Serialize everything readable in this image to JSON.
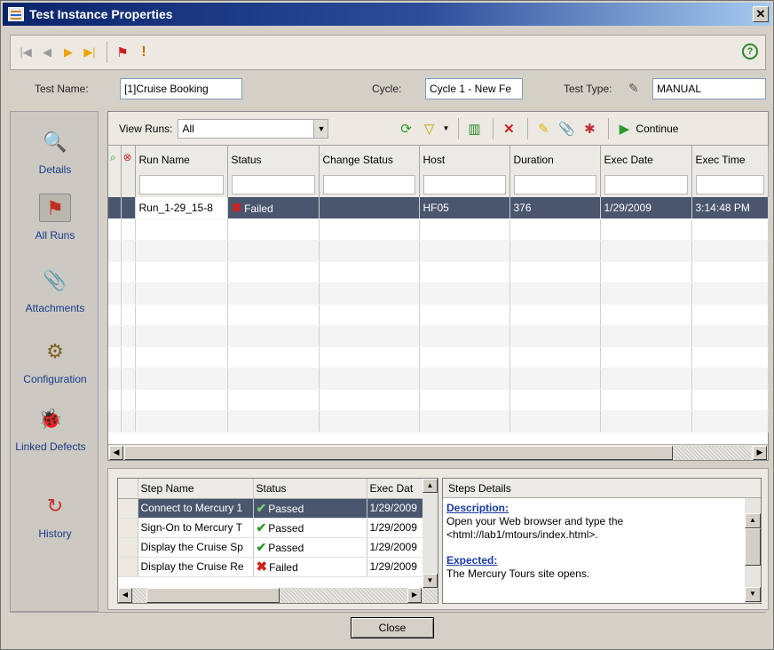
{
  "window": {
    "title": "Test Instance Properties"
  },
  "fields": {
    "test_name_label": "Test Name:",
    "test_name_value": "[1]Cruise Booking",
    "cycle_label": "Cycle:",
    "cycle_value": "Cycle 1 - New Fe",
    "test_type_label": "Test Type:",
    "test_type_value": "MANUAL"
  },
  "sidebar": {
    "items": [
      {
        "label": "Details",
        "icon": "details-icon"
      },
      {
        "label": "All Runs",
        "icon": "runs-icon",
        "selected": true
      },
      {
        "label": "Attachments",
        "icon": "paperclip-icon"
      },
      {
        "label": "Configuration",
        "icon": "configuration-icon"
      },
      {
        "label": "Linked Defects",
        "icon": "linked-defects-icon"
      },
      {
        "label": "History",
        "icon": "history-icon"
      }
    ]
  },
  "runs_toolbar": {
    "view_runs_label": "View Runs:",
    "view_runs_value": "All",
    "continue_label": "Continue"
  },
  "runs_grid": {
    "columns": [
      "Run Name",
      "Status",
      "Change Status",
      "Host",
      "Duration",
      "Exec Date",
      "Exec Time"
    ],
    "rows": [
      {
        "run_name": "Run_1-29_15-8",
        "status": "Failed",
        "change_status": "",
        "host": "HF05",
        "duration": "376",
        "exec_date": "1/29/2009",
        "exec_time": "3:14:48 PM"
      }
    ]
  },
  "steps_grid": {
    "columns": [
      "Step Name",
      "Status",
      "Exec Dat"
    ],
    "rows": [
      {
        "step": "Connect to Mercury 1",
        "status": "Passed",
        "date": "1/29/2009"
      },
      {
        "step": "Sign-On to Mercury T",
        "status": "Passed",
        "date": "1/29/2009"
      },
      {
        "step": "Display the Cruise Sp",
        "status": "Passed",
        "date": "1/29/2009"
      },
      {
        "step": "Display the Cruise Re",
        "status": "Failed",
        "date": "1/29/2009"
      }
    ]
  },
  "steps_details": {
    "title": "Steps Details",
    "description_label": "Description:",
    "description_text": "Open your Web browser and type the <html://lab1/mtours/index.html>.",
    "expected_label": "Expected:",
    "expected_text": "The Mercury Tours site opens."
  },
  "footer": {
    "close_label": "Close"
  },
  "colors": {
    "title_bar": "#0a246a",
    "selection": "#4a566e",
    "failed": "#d02020",
    "passed": "#2a9a2a",
    "link": "#1a3aa0"
  }
}
